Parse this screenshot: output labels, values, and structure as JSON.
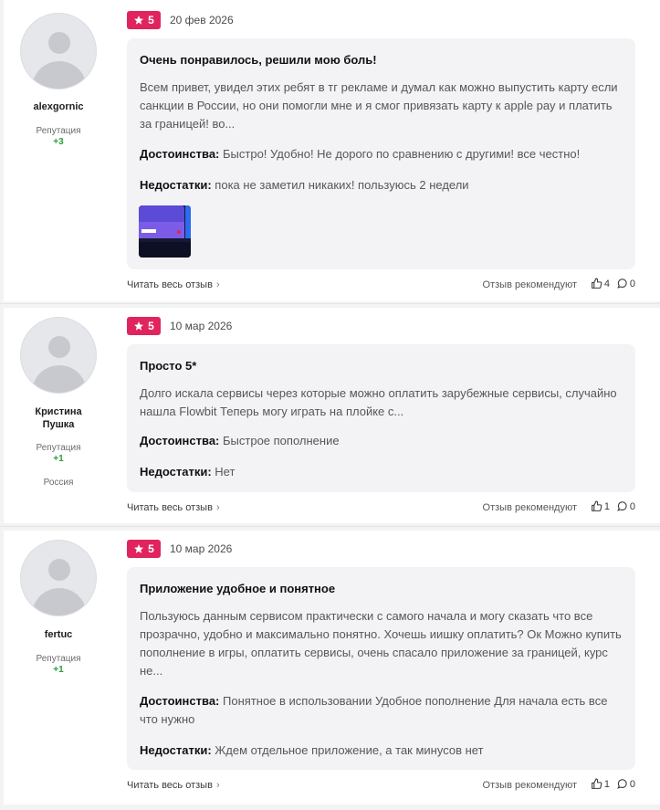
{
  "ui": {
    "reputation_label": "Репутация",
    "read_more": "Читать весь отзыв",
    "recommend_label": "Отзыв рекомендуют",
    "pros_label": "Достоинства:",
    "cons_label": "Недостатки:"
  },
  "reviews": [
    {
      "author": "alexgornic",
      "reputation": "+3",
      "rating": "5",
      "date": "20 фев 2026",
      "title": "Очень понравилось, решили мою боль!",
      "text": "Всем привет, увидел этих ребят в тг рекламе и думал как можно выпустить карту если санкции в России, но они помогли мне и я смог привязать карту к apple pay и платить за границей! во...",
      "pros": "Быстро! Удобно! Не дорого по сравнению с другими! все честно!",
      "cons": "пока не заметил никаких! пользуюсь 2 недели",
      "likes": "4",
      "comments": "0"
    },
    {
      "author": "Кристина Пушка",
      "reputation": "+1",
      "country": "Россия",
      "rating": "5",
      "date": "10 мар 2026",
      "title": "Просто 5*",
      "text": "Долго искала сервисы через которые можно оплатить зарубежные сервисы, случайно нашла Flowbit Теперь могу играть на плойке с...",
      "pros": "Быстрое пополнение",
      "cons": "Нет",
      "likes": "1",
      "comments": "0"
    },
    {
      "author": "fertuc",
      "reputation": "+1",
      "rating": "5",
      "date": "10 мар 2026",
      "title": "Приложение удобное и понятное",
      "text": "Пользуюсь данным сервисом практически с самого начала и могу сказать что все прозрачно, удобно и максимально понятно. Хочешь иишку оплатить? Ок Можно купить пополнение в игры, оплатить сервисы, очень спасало приложение за границей, курс не...",
      "pros": "Понятное в использовании Удобное пополнение Для начала есть все что нужно",
      "cons": "Ждем отдельное приложение, а так минусов нет",
      "likes": "1",
      "comments": "0"
    }
  ],
  "colors": {
    "badge": "#e0245e",
    "reputation": "#2a9d3a"
  }
}
